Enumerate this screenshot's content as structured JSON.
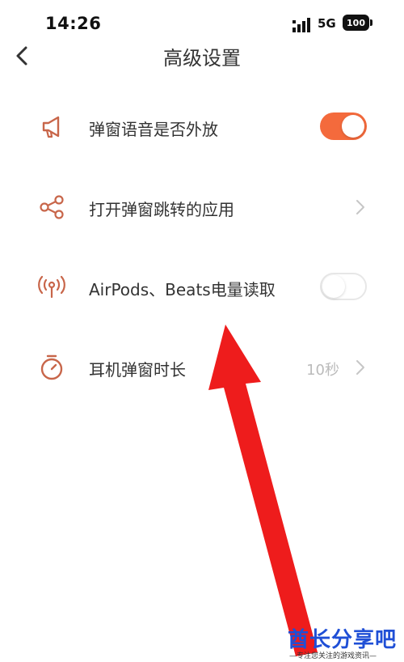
{
  "status_bar": {
    "time": "14:26",
    "network": "5G",
    "battery": "100",
    "signal_icon": "signal-bars-icon"
  },
  "header": {
    "title": "高级设置",
    "back_icon": "chevron-left-icon"
  },
  "settings": [
    {
      "icon": "megaphone-icon",
      "label": "弹窗语音是否外放",
      "control": "toggle",
      "enabled": true
    },
    {
      "icon": "share-icon",
      "label": "打开弹窗跳转的应用",
      "control": "chevron"
    },
    {
      "icon": "broadcast-icon",
      "label": "AirPods、Beats电量读取",
      "control": "toggle",
      "enabled": false
    },
    {
      "icon": "timer-icon",
      "label": "耳机弹窗时长",
      "value": "10秒",
      "control": "chevron"
    }
  ],
  "colors": {
    "accent": "#f46a3c",
    "icon": "#c8664a",
    "arrow": "#ee1c1c",
    "watermark": "#1f4fd6"
  },
  "watermark": {
    "title": "酋长分享吧",
    "subtitle": "—专注您关注的游戏资讯—"
  }
}
